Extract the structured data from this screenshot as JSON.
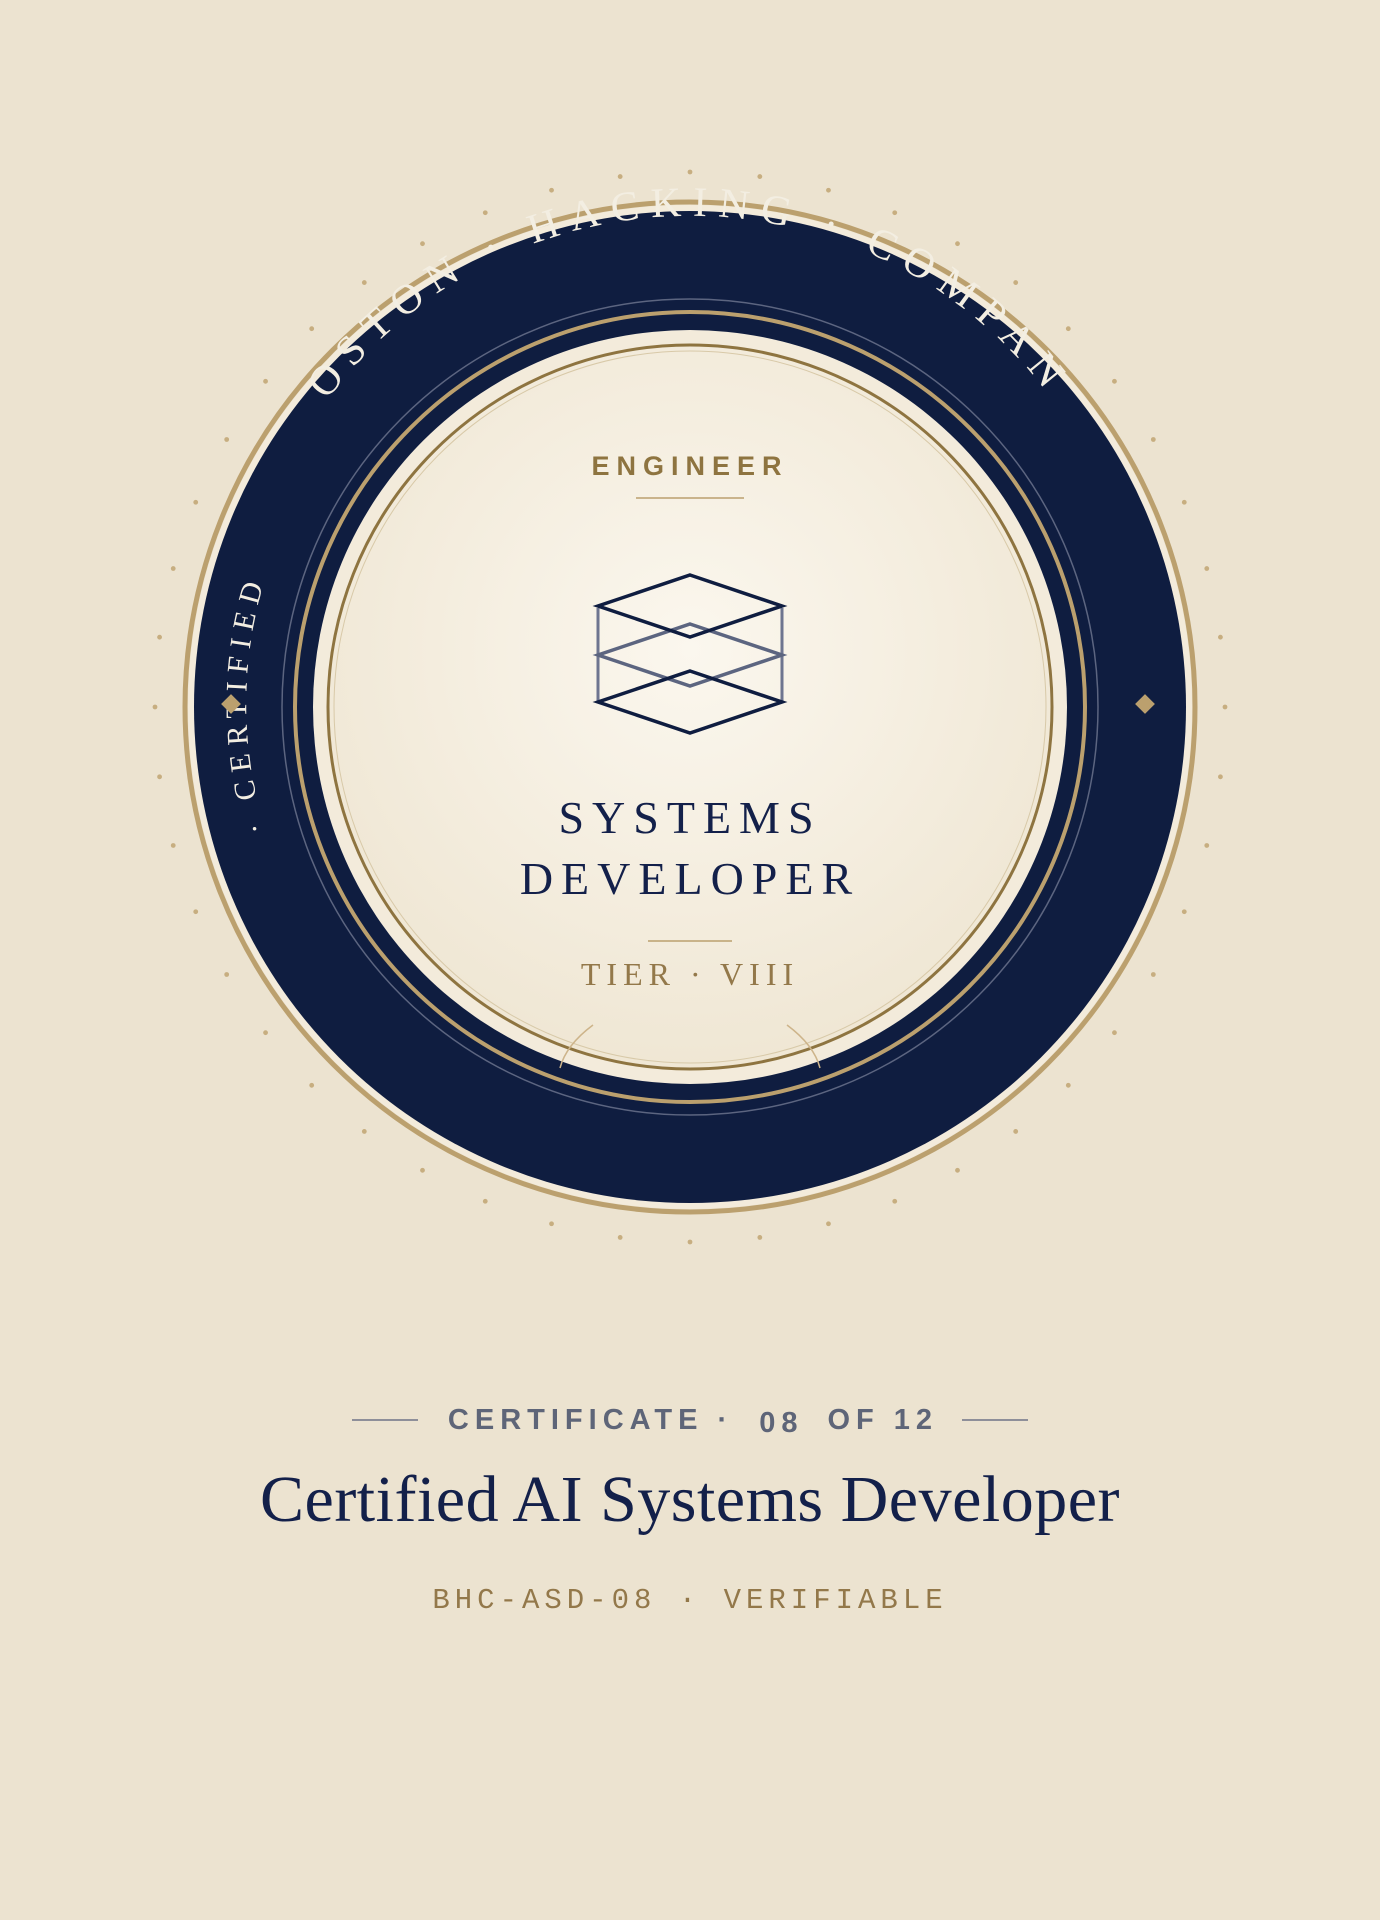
{
  "badge": {
    "ring_text": "BOSTON · HACKING · COMPANY",
    "side_text": "· CERTIFIED",
    "level": "ENGINEER",
    "name_line1": "SYSTEMS",
    "name_line2": "DEVELOPER",
    "tier": "TIER · VIII",
    "icon": "stacked-layers-icon"
  },
  "certificate": {
    "label": "CERTIFICATE ·",
    "number": "08",
    "of_total": "OF 12",
    "title": "Certified AI Systems Developer",
    "code_line": "BHC-ASD-08 · VERIFIABLE"
  },
  "colors": {
    "background": "#ECE3D0",
    "navy": "#0F1D40",
    "gold": "#BBA06E",
    "dark_gold": "#8E7440",
    "center_light": "#FAF5EA"
  }
}
